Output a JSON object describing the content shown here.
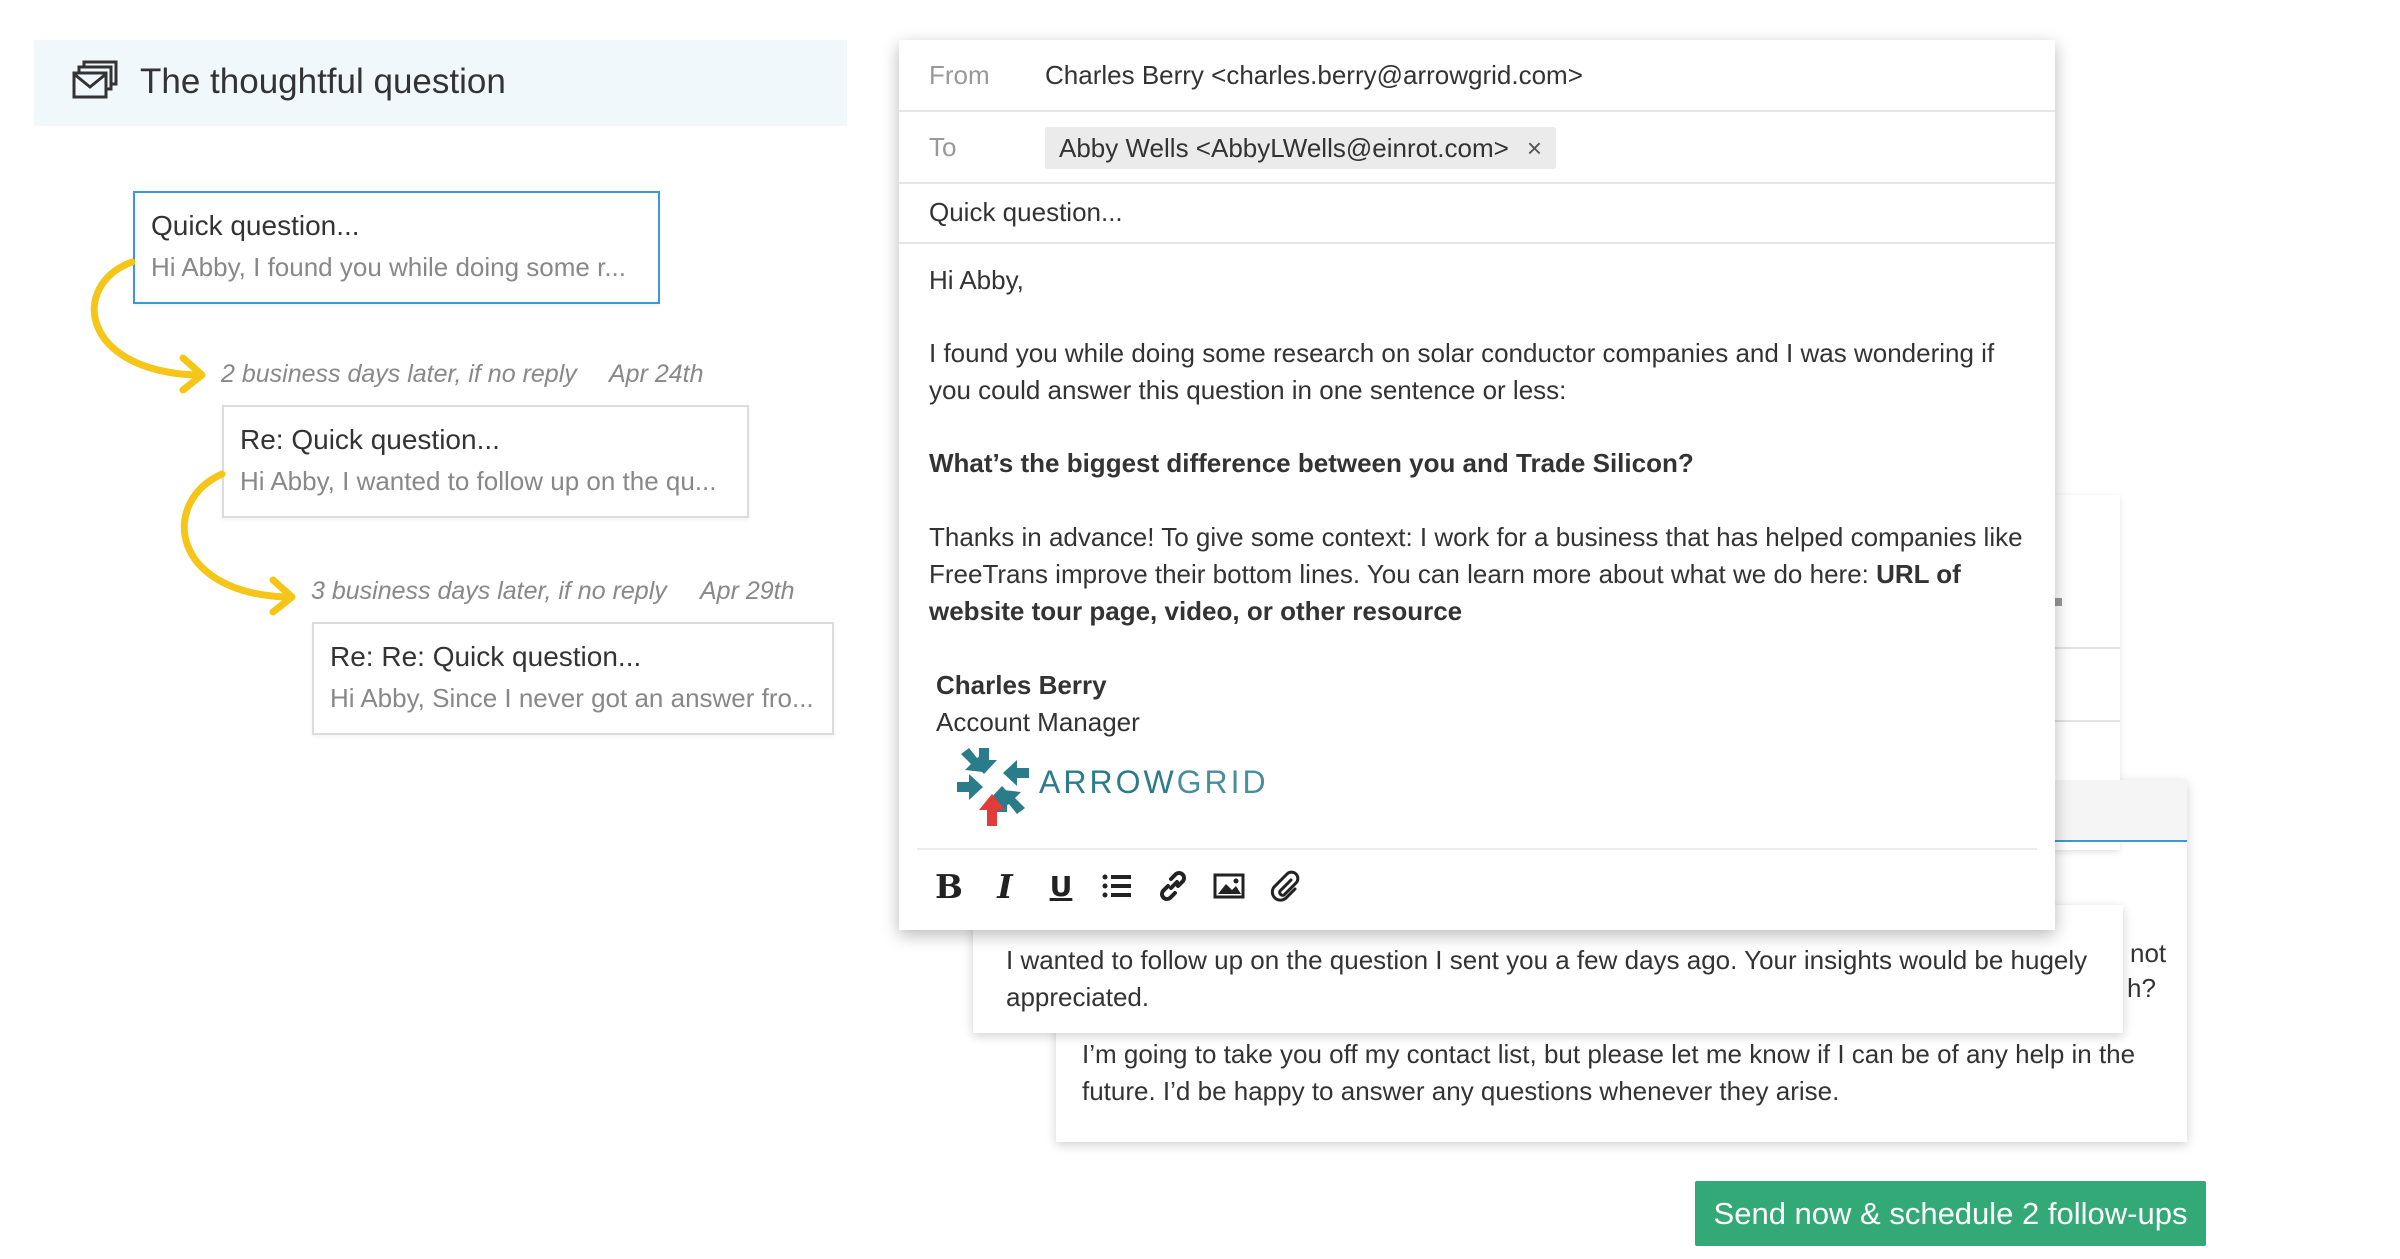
{
  "header": {
    "title": "The thoughtful question",
    "icon": "stacked-emails-icon"
  },
  "sequence": {
    "steps": [
      {
        "subject": "Quick question...",
        "preview": "Hi Abby, I found you while doing some r..."
      },
      {
        "delay": "2 business days later, if no reply",
        "date": "Apr 24th",
        "subject": "Re: Quick question...",
        "preview": "Hi Abby, I wanted to follow up on the qu..."
      },
      {
        "delay": "3 business days later, if no reply",
        "date": "Apr 29th",
        "subject": "Re: Re: Quick question...",
        "preview": "Hi Abby, Since I never got an answer fro..."
      }
    ]
  },
  "composer": {
    "from_label": "From",
    "from_value": "Charles Berry <charles.berry@arrowgrid.com>",
    "to_label": "To",
    "to_chip": "Abby Wells <AbbyLWells@einrot.com>",
    "to_chip_remove": "×",
    "subject": "Quick question...",
    "greeting": "Hi Abby,",
    "para1_line1": "I found you while doing some research on solar conductor companies and I was wondering if",
    "para1_line2": "you could answer this question in one sentence or less:",
    "question": "What’s the biggest difference between you and Trade Silicon?",
    "para3_line1": "Thanks in advance! To give some context: I work for a business that has helped companies like",
    "para3_line2_a": "FreeTrans improve their bottom lines. You can learn more about what we do here: ",
    "para3_line2_b": "URL of",
    "para3_line3": "website tour page, video, or other resource",
    "sig_name": "Charles Berry",
    "sig_title": "Account Manager",
    "logo_text_a": "ARROW",
    "logo_text_b": "GRID",
    "toolbar": [
      "bold-icon",
      "italic-icon",
      "underline-icon",
      "list-icon",
      "link-icon",
      "image-icon",
      "attachment-icon"
    ]
  },
  "followup1": {
    "line1": "I wanted to follow up on the question I sent you a few days ago. Your insights would be hugely",
    "line2": "appreciated.",
    "peek1": "not",
    "peek2": "h?"
  },
  "followup2": {
    "line1": "I’m going to take you off my contact list, but please let me know if I can be of any help in the",
    "line2": "future. I’d be happy to answer any questions whenever they arise."
  },
  "send_button": "Send now & schedule 2 follow-ups",
  "colors": {
    "accent_blue": "#3a9ad6",
    "arrow_yellow": "#f5c518",
    "send_green": "#33a977",
    "logo_teal": "#2a7c8a",
    "logo_red": "#e23b3b"
  }
}
